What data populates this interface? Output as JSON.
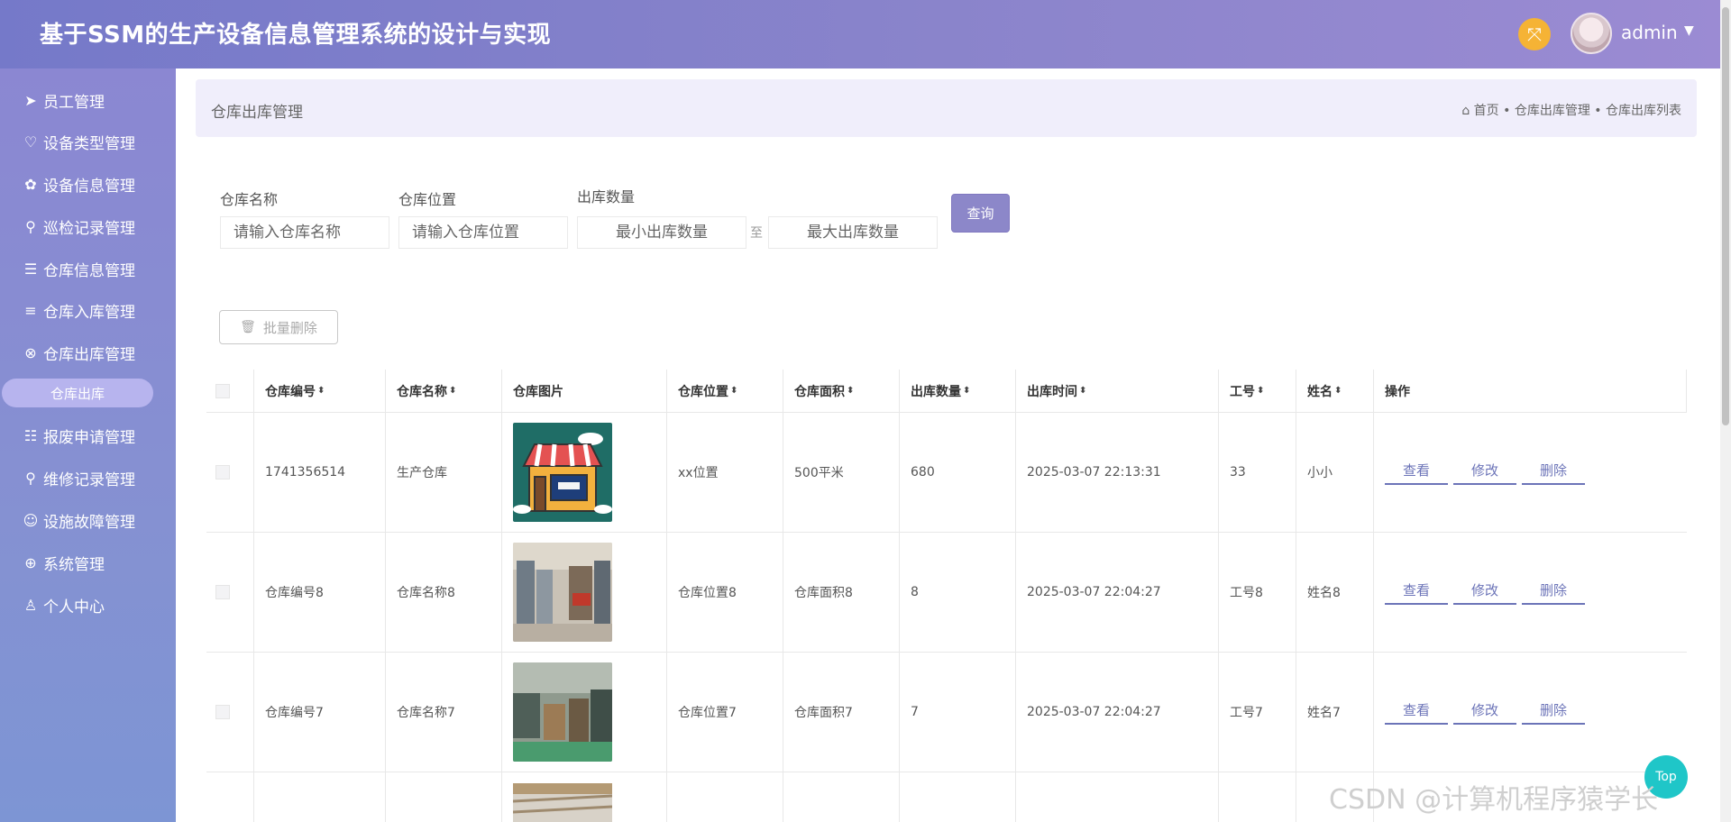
{
  "header": {
    "title": "基于SSM的生产设备信息管理系统的设计与实现",
    "user": "admin"
  },
  "sidebar": {
    "items": [
      {
        "label": "员工管理",
        "icon": "send-icon"
      },
      {
        "label": "设备类型管理",
        "icon": "heart-icon"
      },
      {
        "label": "设备信息管理",
        "icon": "palette-icon"
      },
      {
        "label": "巡检记录管理",
        "icon": "key-icon"
      },
      {
        "label": "仓库信息管理",
        "icon": "list-indent-icon"
      },
      {
        "label": "仓库入库管理",
        "icon": "list-icon"
      },
      {
        "label": "仓库出库管理",
        "icon": "circle-x-icon"
      },
      {
        "label": "报废申请管理",
        "icon": "list-check-icon"
      },
      {
        "label": "维修记录管理",
        "icon": "search-icon"
      },
      {
        "label": "设施故障管理",
        "icon": "user-circle-icon"
      },
      {
        "label": "系统管理",
        "icon": "upload-circle-icon"
      },
      {
        "label": "个人中心",
        "icon": "user-icon"
      }
    ],
    "active_sub": "仓库出库"
  },
  "breadcrumb": {
    "page_title": "仓库出库管理",
    "home": "首页",
    "section": "仓库出库管理",
    "current": "仓库出库列表",
    "sep": "•"
  },
  "search": {
    "name_label": "仓库名称",
    "name_placeholder": "请输入仓库名称",
    "location_label": "仓库位置",
    "location_placeholder": "请输入仓库位置",
    "qty_label": "出库数量",
    "min_placeholder": "最小出库数量",
    "max_placeholder": "最大出库数量",
    "range_sep": "至",
    "query_label": "查询"
  },
  "toolbar": {
    "batch_delete": "批量删除"
  },
  "table": {
    "columns": [
      "仓库编号",
      "仓库名称",
      "仓库图片",
      "仓库位置",
      "仓库面积",
      "出库数量",
      "出库时间",
      "工号",
      "姓名",
      "操作"
    ],
    "actions": [
      "查看",
      "修改",
      "删除"
    ],
    "rows": [
      {
        "id": "1741356514",
        "name": "生产仓库",
        "image": "store-illustration",
        "location": "xx位置",
        "area": "500平米",
        "qty": "680",
        "time": "2025-03-07 22:13:31",
        "job": "33",
        "person": "小小"
      },
      {
        "id": "仓库编号8",
        "name": "仓库名称8",
        "image": "warehouse-photo",
        "location": "仓库位置8",
        "area": "仓库面积8",
        "qty": "8",
        "time": "2025-03-07 22:04:27",
        "job": "工号8",
        "person": "姓名8"
      },
      {
        "id": "仓库编号7",
        "name": "仓库名称7",
        "image": "warehouse-photo",
        "location": "仓库位置7",
        "area": "仓库面积7",
        "qty": "7",
        "time": "2025-03-07 22:04:27",
        "job": "工号7",
        "person": "姓名7"
      }
    ]
  },
  "watermark": "CSDN @计算机程序猿学长",
  "top_button": "Top"
}
